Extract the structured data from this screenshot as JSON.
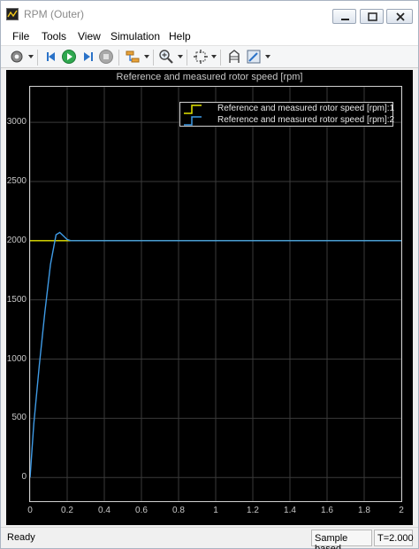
{
  "window": {
    "title": "RPM (Outer)"
  },
  "menu": {
    "items": [
      "File",
      "Tools",
      "View",
      "Simulation",
      "Help"
    ]
  },
  "toolbar": {
    "icons": [
      "settings-icon",
      "step-back-icon",
      "run-icon",
      "step-forward-icon",
      "stop-icon",
      "highlight-signal-icon",
      "zoom-icon",
      "fit-to-view-icon",
      "cursor-measurements-icon",
      "style-icon"
    ]
  },
  "status": {
    "ready": "Ready",
    "mode": "Sample based",
    "time": "T=2.000"
  },
  "colors": {
    "series1": "#e6e600",
    "series2": "#3f9be6",
    "background": "#000000",
    "grid": "#3a3a3a",
    "axis_text": "#c8c8c8"
  },
  "chart_data": {
    "type": "line",
    "title": "Reference and measured rotor speed [rpm]",
    "xlabel": "",
    "ylabel": "",
    "xlim": [
      0,
      2
    ],
    "ylim": [
      -200,
      3300
    ],
    "x_ticks": [
      "0",
      "0.2",
      "0.4",
      "0.6",
      "0.8",
      "1",
      "1.2",
      "1.4",
      "1.6",
      "1.8",
      "2"
    ],
    "y_ticks": [
      "0",
      "500",
      "1000",
      "1500",
      "2000",
      "2500",
      "3000"
    ],
    "grid": true,
    "legend_position": "top-right",
    "series": [
      {
        "name": "Reference and measured rotor speed [rpm]:1",
        "x": [
          0,
          2
        ],
        "y": [
          2000,
          2000
        ]
      },
      {
        "name": "Reference and measured rotor speed [rpm]:2",
        "x": [
          0,
          0.02,
          0.05,
          0.08,
          0.11,
          0.14,
          0.16,
          0.18,
          0.2,
          0.22,
          0.25,
          0.3,
          2
        ],
        "y": [
          0,
          450,
          950,
          1400,
          1800,
          2050,
          2070,
          2040,
          2010,
          2000,
          2000,
          2000,
          2000
        ]
      }
    ]
  }
}
